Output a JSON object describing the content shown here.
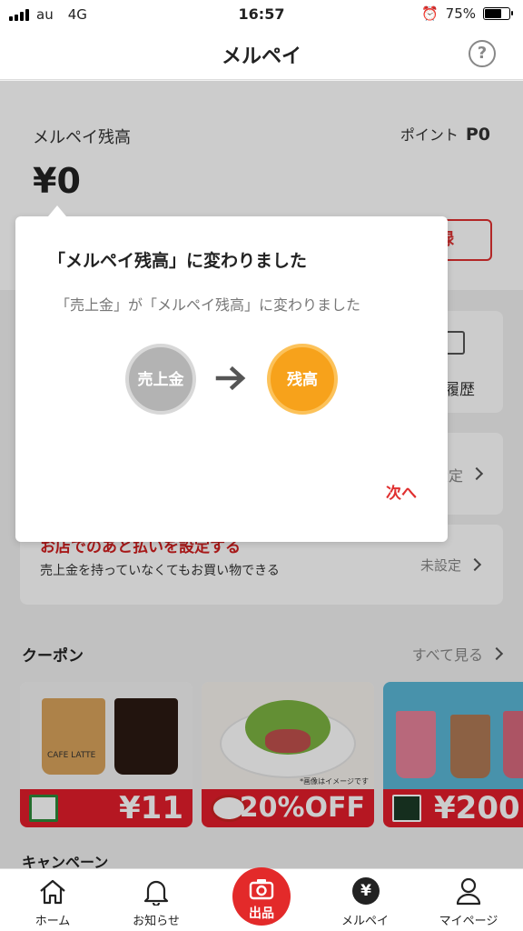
{
  "status_bar": {
    "carrier": "au",
    "network": "4G",
    "time": "16:57",
    "battery": "75%",
    "battery_level": 0.75
  },
  "header": {
    "title": "メルペイ",
    "help": "?"
  },
  "balance": {
    "label": "メルペイ残高",
    "points_label": "ポイント",
    "points_value": "P0",
    "amount": "¥0",
    "register_button": "録"
  },
  "tiles": {
    "history_label": "い履歴",
    "settings_label": "設定"
  },
  "deferred_payment": {
    "title": "お店でのあと払いを設定する",
    "subtitle": "売上金を持っていなくてもお買い物できる",
    "status": "未設定"
  },
  "coupons": {
    "heading": "クーポン",
    "see_all": "すべて見る",
    "items": [
      {
        "value": "¥11",
        "image_text": "CAFE LATTE"
      },
      {
        "value": "20%OFF",
        "image_text": "*画像はイメージです"
      },
      {
        "value": "¥200"
      }
    ]
  },
  "campaign": {
    "heading": "キャンペーン"
  },
  "tabbar": {
    "home": "ホーム",
    "notifications": "お知らせ",
    "sell": "出品",
    "merpay": "メルペイ",
    "mypage": "マイページ"
  },
  "modal": {
    "title": "「メルペイ残高」に変わりました",
    "description": "「売上金」が「メルペイ残高」に変わりました",
    "from_label": "売上金",
    "to_label": "残高",
    "next_button": "次へ"
  },
  "colors": {
    "accent_red": "#e03030",
    "orange": "#f7a21b",
    "grey": "#b3b3b3"
  }
}
